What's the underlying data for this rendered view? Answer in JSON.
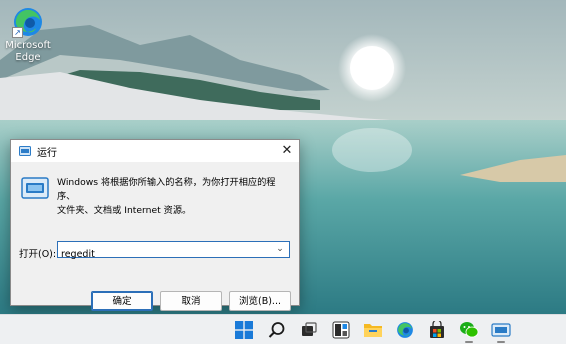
{
  "desktop": {
    "icon_label_line1": "Microsoft",
    "icon_label_line2": "Edge"
  },
  "dialog": {
    "title": "运行",
    "close_glyph": "✕",
    "description_line1": "Windows 将根据你所输入的名称，为你打开相应的程序、",
    "description_line2": "文件夹、文档或 Internet 资源。",
    "open_label": "打开(O):",
    "input_value": "regedit",
    "ok_label": "确定",
    "cancel_label": "取消",
    "browse_label": "浏览(B)..."
  },
  "taskbar": {
    "items": [
      "start",
      "search",
      "task-view",
      "widgets",
      "file-explorer",
      "edge",
      "store",
      "wechat",
      "remote-desktop"
    ]
  }
}
